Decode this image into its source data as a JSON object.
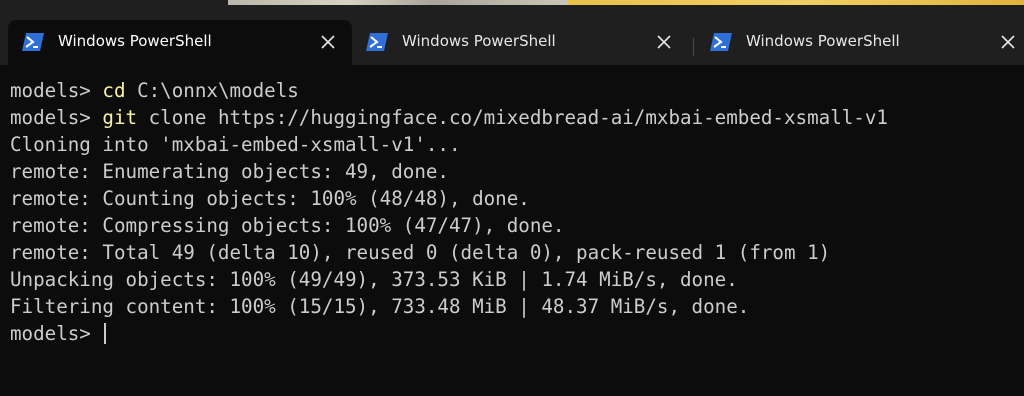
{
  "tabs": [
    {
      "label": "Windows PowerShell",
      "active": true,
      "icon": "powershell-icon"
    },
    {
      "label": "Windows PowerShell",
      "active": false,
      "icon": "powershell-icon"
    },
    {
      "label": "Windows PowerShell",
      "active": false,
      "icon": "powershell-icon"
    }
  ],
  "terminal": {
    "lines": [
      {
        "prompt": "models> ",
        "command": "cd",
        "rest": " C:\\onnx\\models"
      },
      {
        "prompt": "models> ",
        "command": "git",
        "rest": " clone https://huggingface.co/mixedbread-ai/mxbai-embed-xsmall-v1"
      },
      {
        "text": "Cloning into 'mxbai-embed-xsmall-v1'..."
      },
      {
        "text": "remote: Enumerating objects: 49, done."
      },
      {
        "text": "remote: Counting objects: 100% (48/48), done."
      },
      {
        "text": "remote: Compressing objects: 100% (47/47), done."
      },
      {
        "text": "remote: Total 49 (delta 10), reused 0 (delta 0), pack-reused 1 (from 1)"
      },
      {
        "text": "Unpacking objects: 100% (49/49), 373.53 KiB | 1.74 MiB/s, done."
      },
      {
        "text": "Filtering content: 100% (15/15), 733.48 MiB | 48.37 MiB/s, done."
      }
    ],
    "current_prompt": "models> "
  },
  "colors": {
    "background": "#0c0c0c",
    "tabbar": "#1f1f1f",
    "text": "#cccccc",
    "command": "#f9f1a5",
    "powershell_icon": "#2f6fd6"
  }
}
